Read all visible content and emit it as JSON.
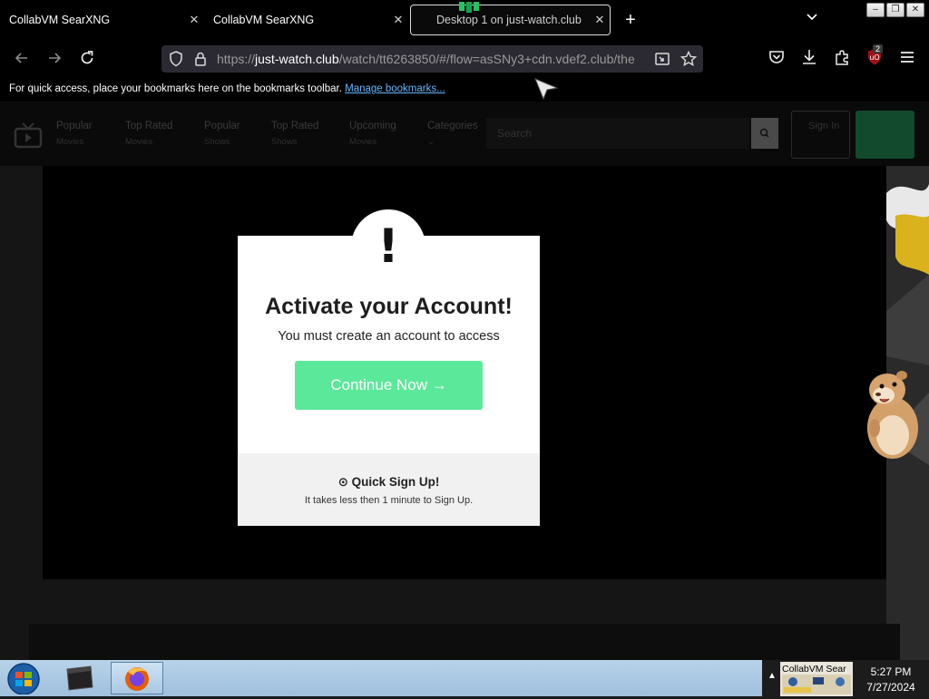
{
  "tabs": [
    {
      "title": "CollabVM SearXNG",
      "active": false
    },
    {
      "title": "CollabVM SearXNG",
      "active": false
    },
    {
      "title": "Desktop 1 on just-watch.club",
      "active": true
    }
  ],
  "url": {
    "prefix": "https://",
    "host": "just-watch.club",
    "path": "/watch/tt6263850/#/flow=asSNy3+cdn.vdef2.club/the"
  },
  "bookmarks_bar": {
    "message": "For quick access, place your bookmarks here on the bookmarks toolbar.",
    "link": "Manage bookmarks..."
  },
  "extension_badge": "2",
  "site_nav": [
    {
      "label": "Popular",
      "sub": "Movies"
    },
    {
      "label": "Top Rated",
      "sub": "Movies"
    },
    {
      "label": "Popular",
      "sub": "Shows"
    },
    {
      "label": "Top Rated",
      "sub": "Shows"
    },
    {
      "label": "Upcoming",
      "sub": "Movies"
    },
    {
      "label": "Categories",
      "sub": "⌄"
    }
  ],
  "site_search_placeholder": "Search",
  "signin": "Sign In",
  "modal": {
    "icon": "!",
    "title": "Activate your Account!",
    "subtitle": "You must create an account to access",
    "button": "Continue Now →",
    "footer_title": "⊙ Quick Sign Up!",
    "footer_text": "It takes less then 1 minute to Sign Up."
  },
  "taskbar": {
    "tray_thumb": "CollabVM Sear",
    "time": "5:27 PM",
    "date": "7/27/2024"
  },
  "colors": {
    "accent_green": "#5be89a",
    "link_blue": "#63b7ff"
  }
}
